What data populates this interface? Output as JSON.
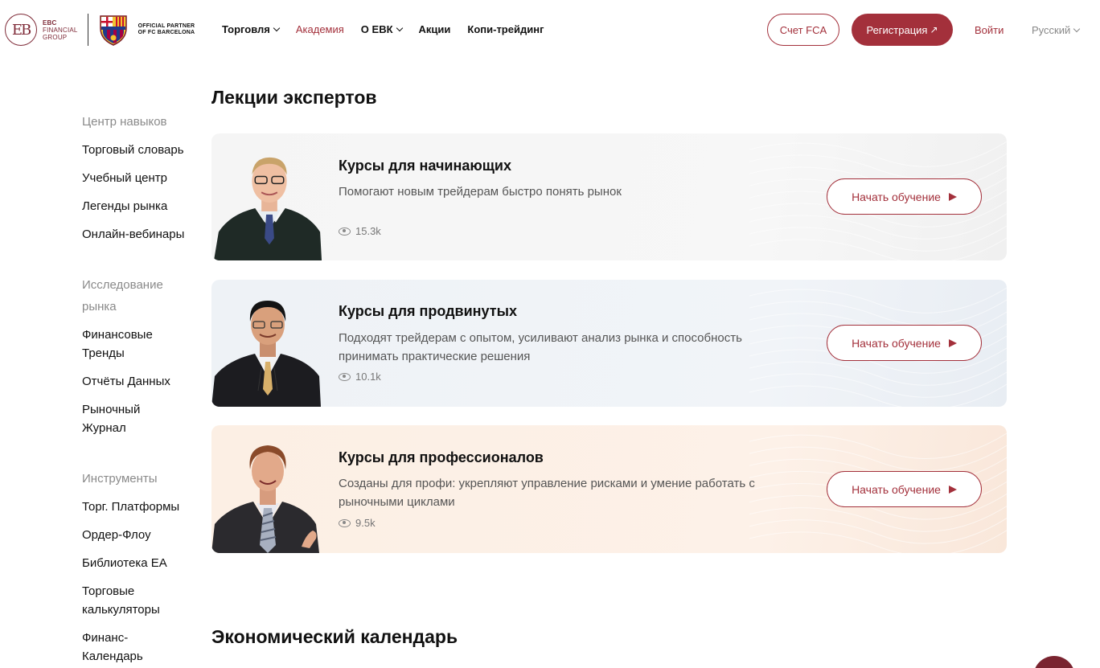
{
  "header": {
    "brand_line1": "EBC",
    "brand_line2": "FINANCIAL",
    "brand_line3": "GROUP",
    "partner_line1": "OFFICIAL PARTNER",
    "partner_line2": "OF FC BARCELONA",
    "nav": [
      {
        "label": "Торговля",
        "has_dropdown": true
      },
      {
        "label": "Академия",
        "active": true
      },
      {
        "label": "О ЕВК",
        "has_dropdown": true
      },
      {
        "label": "Акции"
      },
      {
        "label": "Копи-трейдинг"
      }
    ],
    "fca_label": "Счет FCA",
    "register_label": "Регистрация",
    "login_label": "Войти",
    "language": "Русский"
  },
  "sidebar": {
    "groups": [
      {
        "title": "Центр навыков",
        "items": [
          "Торговый словарь",
          "Учебный центр",
          "Легенды рынка",
          "Онлайн-вебинары"
        ]
      },
      {
        "title": "Исследование рынка",
        "items": [
          "Финансовые Тренды",
          "Отчёты Данных",
          "Рыночный Журнал"
        ]
      },
      {
        "title": "Инструменты",
        "items": [
          "Торг. Платформы",
          "Ордер-Флоу",
          "Библиотека ЕА",
          "Торговые калькуляторы",
          "Финанс-Календарь"
        ]
      }
    ]
  },
  "main": {
    "lectures_title": "Лекции экспертов",
    "calendar_title": "Экономический календарь",
    "courses": [
      {
        "title": "Курсы для начинающих",
        "description": "Помогают новым трейдерам быстро понять рынок",
        "views": "15.3k",
        "button": "Начать обучение"
      },
      {
        "title": "Курсы для продвинутых",
        "description": "Подходят трейдерам с опытом, усиливают анализ рынка и способность принимать практические решения",
        "views": "10.1k",
        "button": "Начать обучение"
      },
      {
        "title": "Курсы для профессионалов",
        "description": "Созданы для профи: укрепляют управление рисками и умение работать с рыночными циклами",
        "views": "9.5k",
        "button": "Начать обучение"
      }
    ]
  },
  "colors": {
    "brand": "#a3303b",
    "brand_dark": "#7e2a37"
  }
}
